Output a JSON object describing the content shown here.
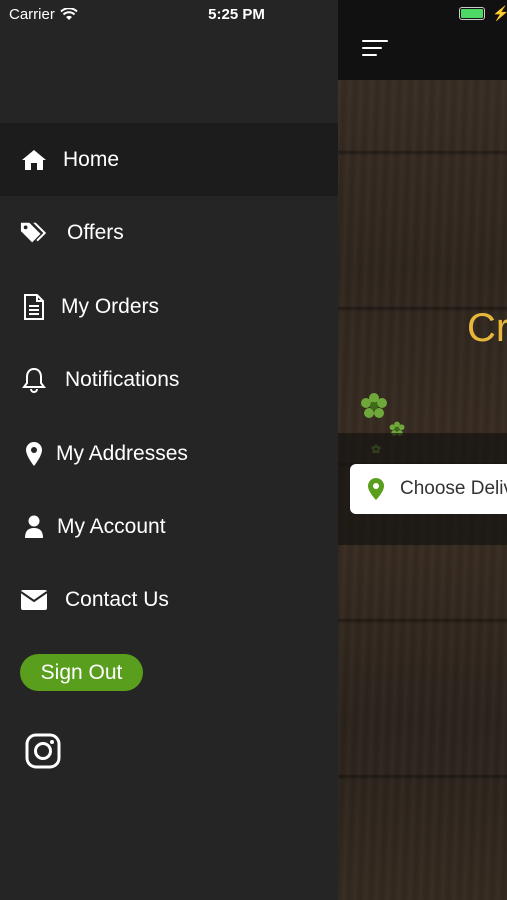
{
  "status_bar": {
    "carrier": "Carrier",
    "time": "5:25 PM",
    "battery_color": "#4cd964"
  },
  "main": {
    "hero_title_partial": "Cr",
    "location_placeholder_partial": "Choose Deliv",
    "accent_color": "#e6b73a",
    "brand_green": "#5a9e1e"
  },
  "menu": {
    "items": [
      {
        "label": "Home",
        "icon": "home-icon"
      },
      {
        "label": "Offers",
        "icon": "tags-icon"
      },
      {
        "label": "My Orders",
        "icon": "document-icon"
      },
      {
        "label": "Notifications",
        "icon": "bell-icon"
      },
      {
        "label": "My Addresses",
        "icon": "map-pin-icon"
      },
      {
        "label": "My Account",
        "icon": "user-icon"
      },
      {
        "label": "Contact Us",
        "icon": "envelope-icon"
      }
    ],
    "signout_label": "Sign Out",
    "social_icon": "instagram-icon"
  }
}
